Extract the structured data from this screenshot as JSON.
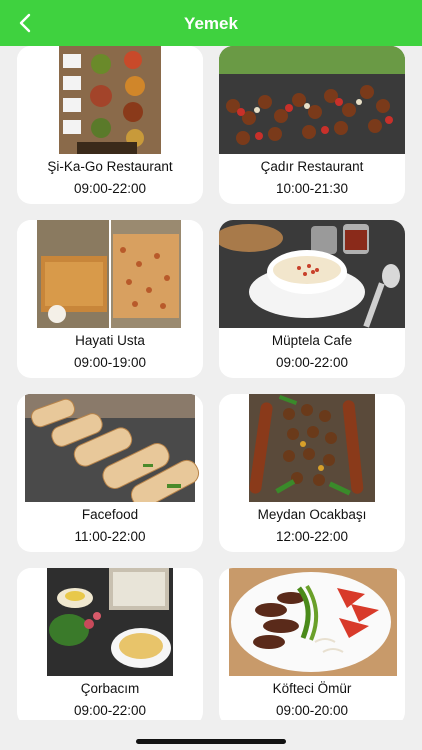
{
  "header": {
    "title": "Yemek",
    "back_icon": "chevron-left-icon"
  },
  "restaurants": [
    {
      "name": "Şi-Ka-Go Restaurant",
      "hours": "09:00-22:00"
    },
    {
      "name": "Çadır Restaurant",
      "hours": "10:00-21:30"
    },
    {
      "name": "Hayati Usta",
      "hours": "09:00-19:00"
    },
    {
      "name": "Müptela Cafe",
      "hours": "09:00-22:00"
    },
    {
      "name": "Facefood",
      "hours": "11:00-22:00"
    },
    {
      "name": "Meydan Ocakbaşı",
      "hours": "12:00-22:00"
    },
    {
      "name": "Çorbacım",
      "hours": "09:00-22:00"
    },
    {
      "name": "Köfteci Ömür",
      "hours": "09:00-20:00"
    }
  ],
  "colors": {
    "header": "#3fd23f",
    "background": "#efefef",
    "card": "#ffffff"
  }
}
